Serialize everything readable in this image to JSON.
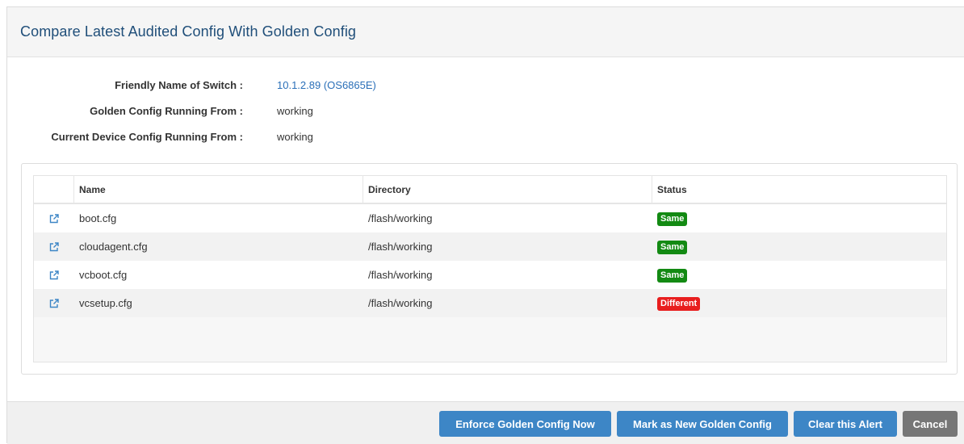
{
  "dialog": {
    "title": "Compare Latest Audited Config With Golden Config"
  },
  "info": [
    {
      "label": "Friendly Name of Switch :",
      "value": "10.1.2.89 (OS6865E)"
    },
    {
      "label": "Golden Config Running From :",
      "value": "working"
    },
    {
      "label": "Current Device Config Running From :",
      "value": "working"
    }
  ],
  "table": {
    "columns": [
      "Name",
      "Directory",
      "Status"
    ],
    "rows": [
      {
        "name": "boot.cfg",
        "directory": "/flash/working",
        "status": "Same"
      },
      {
        "name": "cloudagent.cfg",
        "directory": "/flash/working",
        "status": "Same"
      },
      {
        "name": "vcboot.cfg",
        "directory": "/flash/working",
        "status": "Same"
      },
      {
        "name": "vcsetup.cfg",
        "directory": "/flash/working",
        "status": "Different"
      }
    ],
    "row_icon": "external-link-icon"
  },
  "footer": {
    "enforce_label": "Enforce Golden Config Now",
    "mark_label": "Mark as New Golden Config",
    "clear_label": "Clear this Alert",
    "cancel_label": "Cancel"
  },
  "colors": {
    "title": "#1f4e79",
    "link": "#2a6fb8",
    "status_same": "#138a13",
    "status_different": "#e81e1e",
    "primary_button": "#3d86c6",
    "cancel_button": "#767676"
  }
}
